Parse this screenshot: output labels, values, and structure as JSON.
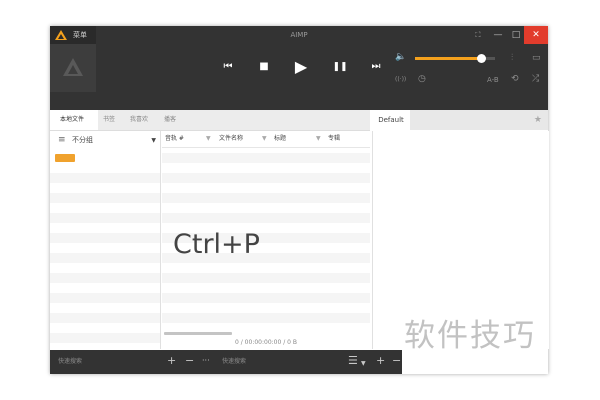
{
  "window": {
    "title": "AIMP",
    "menu_label": "菜单",
    "controls": {
      "pin": "⛶",
      "minimize": "—",
      "maximize": "□",
      "close": "✕"
    }
  },
  "player": {
    "volume_level": 0.83,
    "ab_label": "A-B",
    "accent_color": "#f4a11d"
  },
  "tabs": [
    {
      "label": "本地文件",
      "active": true
    },
    {
      "label": "书签",
      "active": false
    },
    {
      "label": "我喜欢",
      "active": false
    },
    {
      "label": "播客",
      "active": false
    }
  ],
  "library": {
    "group_label": "不分组",
    "columns": [
      {
        "label": "音轨 #"
      },
      {
        "label": "文件名称"
      },
      {
        "label": "标题"
      },
      {
        "label": "专辑"
      }
    ],
    "status": "0 / 00:00:00:00 / 0 B"
  },
  "playlist": {
    "tab_label": "Default"
  },
  "bottom": {
    "left_search_placeholder": "快速搜索",
    "mid_search_placeholder": "快速搜索"
  },
  "overlay_text": "Ctrl+P",
  "watermark_text": "软件技巧",
  "icons": {
    "menu": "≡",
    "star": "★",
    "prev": "⏮",
    "stop": "■",
    "play": "▶",
    "pause": "❚❚",
    "next": "⏭",
    "volume": "🔈",
    "equalizer": "⫶",
    "visualization": "▭",
    "radio": "((·))",
    "timer": "◷",
    "repeat": "⟲",
    "shuffle": "⤮",
    "add": "+",
    "remove": "−",
    "more": "···",
    "playlist_menu": "☰"
  }
}
